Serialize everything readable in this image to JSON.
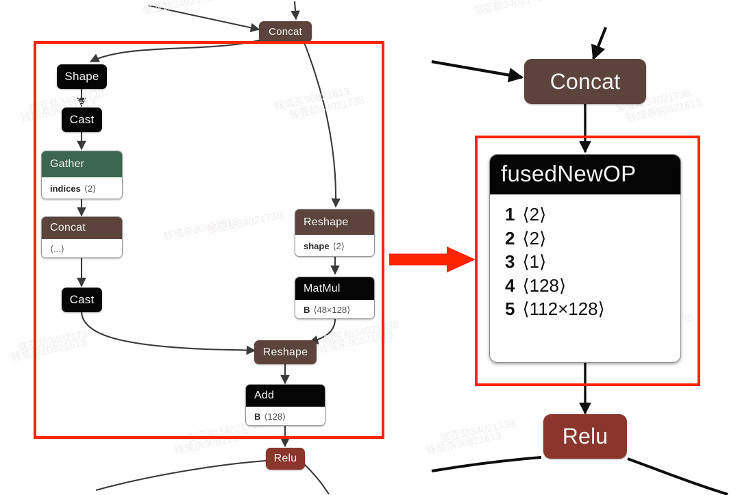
{
  "figure": {
    "description": "ONNX subgraph fusion diagram: a pattern of Shape/Cast/Gather/Concat/Cast/Reshape/MatMul/Reshape/Add nodes inside a red box is replaced by a single fusedNewOP node",
    "accent_red": "#fa2400",
    "colors": {
      "black_node": "#050505",
      "brown_node": "#5c443c",
      "green_node": "#3c6650",
      "red_node": "#8a362c",
      "edge": "#3a3a3a",
      "background": "#ffffff"
    }
  },
  "left_graph": {
    "label": "original-subgraph",
    "nodes": [
      {
        "id": "concat_top",
        "title": "Concat"
      },
      {
        "id": "shape",
        "title": "Shape"
      },
      {
        "id": "cast1",
        "title": "Cast"
      },
      {
        "id": "gather",
        "title": "Gather",
        "attr_key": "indices",
        "attr_val": "⟨2⟩"
      },
      {
        "id": "concat_mid",
        "title": "Concat",
        "attr_key": "",
        "attr_val": "⟨...⟩"
      },
      {
        "id": "cast2",
        "title": "Cast"
      },
      {
        "id": "reshape_top",
        "title": "Reshape",
        "attr_key": "shape",
        "attr_val": "⟨2⟩"
      },
      {
        "id": "matmul",
        "title": "MatMul",
        "attr_key": "B",
        "attr_val": "⟨48×128⟩"
      },
      {
        "id": "reshape_bot",
        "title": "Reshape"
      },
      {
        "id": "add",
        "title": "Add",
        "attr_key": "B",
        "attr_val": "⟨128⟩"
      },
      {
        "id": "relu",
        "title": "Relu"
      }
    ]
  },
  "right_graph": {
    "label": "fused-subgraph",
    "concat_title": "Concat",
    "relu_title": "Relu",
    "fused_node": {
      "title": "fusedNewOP",
      "inputs": [
        {
          "index": "1",
          "shape": "⟨2⟩"
        },
        {
          "index": "2",
          "shape": "⟨2⟩"
        },
        {
          "index": "3",
          "shape": "⟨1⟩"
        },
        {
          "index": "4",
          "shape": "⟨128⟩"
        },
        {
          "index": "5",
          "shape": "⟨112×128⟩"
        }
      ]
    }
  },
  "transform_arrow": {
    "name": "fusion-arrow",
    "color": "#fa2400",
    "direction": "left-to-right"
  },
  "watermarks": [
    "钱成杀90821613",
    "邹亚劫34021738"
  ]
}
